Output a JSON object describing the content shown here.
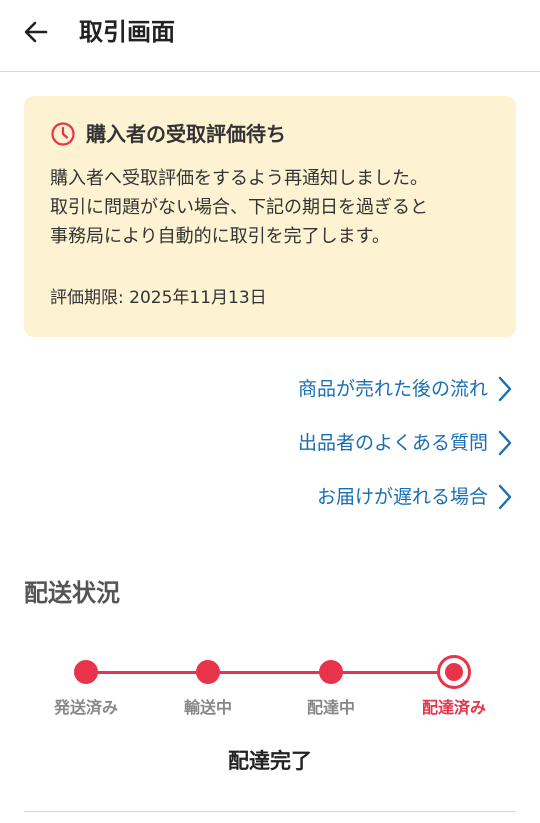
{
  "header": {
    "title": "取引画面",
    "back_icon": "arrow-left-icon"
  },
  "notice": {
    "icon": "clock-icon",
    "title": "購入者の受取評価待ち",
    "body_lines": [
      "購入者へ受取評価をするよう再通知しました。",
      "取引に問題がない場合、下記の期日を過ぎると",
      "事務局により自動的に取引を完了します。"
    ],
    "deadline": "評価期限: 2025年11月13日"
  },
  "links": [
    {
      "label": "商品が売れた後の流れ",
      "icon": "chevron-right-icon"
    },
    {
      "label": "出品者のよくある質問",
      "icon": "chevron-right-icon"
    },
    {
      "label": "お届けが遅れる場合",
      "icon": "chevron-right-icon"
    }
  ],
  "shipping": {
    "section_title": "配送状況",
    "steps": [
      {
        "label": "発送済み",
        "state": "done"
      },
      {
        "label": "輸送中",
        "state": "done"
      },
      {
        "label": "配達中",
        "state": "done"
      },
      {
        "label": "配達済み",
        "state": "current"
      }
    ],
    "status": "配達完了"
  },
  "colors": {
    "accent_red": "#e8334a",
    "link_blue": "#1a6fb3",
    "notice_bg": "#fdf3d2"
  }
}
